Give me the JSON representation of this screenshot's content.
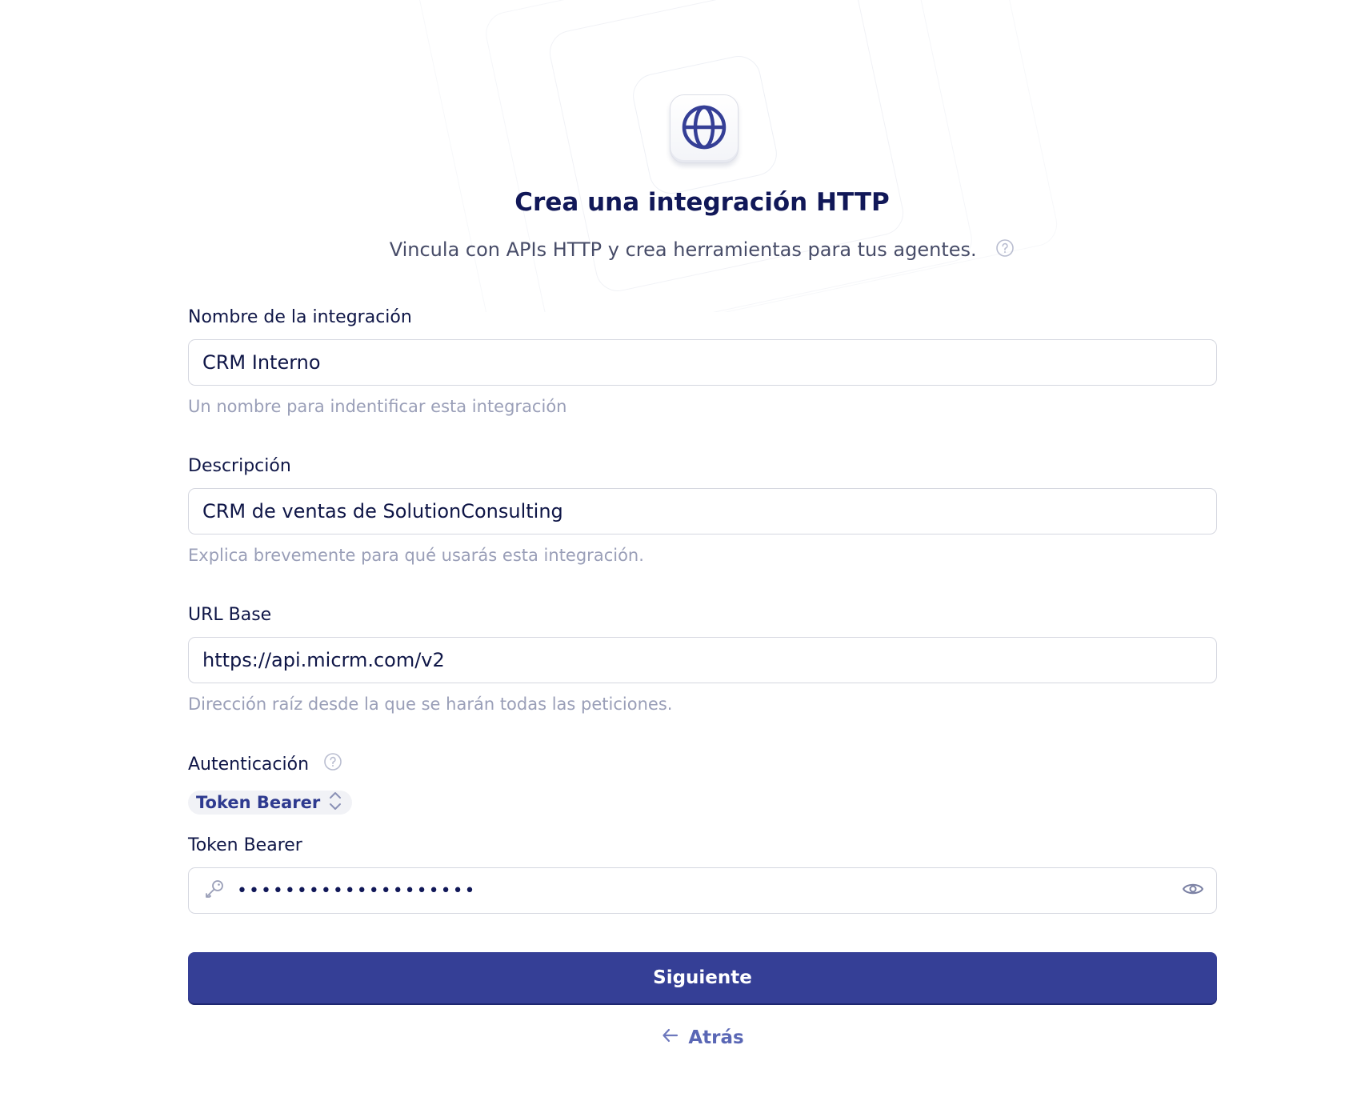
{
  "header": {
    "title": "Crea una integración HTTP",
    "subtitle": "Vincula con APIs HTTP y crea herramientas para tus agentes.",
    "logo_icon": "globe-icon",
    "help_icon": "question-circle-icon"
  },
  "form": {
    "name": {
      "label": "Nombre de la integración",
      "value": "CRM Interno",
      "hint": "Un nombre para indentificar esta integración"
    },
    "description": {
      "label": "Descripción",
      "value": "CRM de ventas de SolutionConsulting",
      "hint": "Explica brevemente para qué usarás esta integración."
    },
    "base_url": {
      "label": "URL Base",
      "value": "https://api.micrm.com/v2",
      "hint": "Dirección raíz desde la que se harán todas las peticiones."
    },
    "auth": {
      "label": "Autenticación",
      "selected": "Token Bearer",
      "select_icon": "chevron-up-down-icon"
    },
    "token": {
      "label": "Token Bearer",
      "value": "••••••••••••••••••••",
      "leading_icon": "key-icon",
      "trailing_icon": "eye-icon"
    }
  },
  "actions": {
    "next_label": "Siguiente",
    "back_label": "Atrás",
    "back_icon": "arrow-left-icon"
  },
  "colors": {
    "primary": "#353f96",
    "heading": "#111858",
    "hint": "#9a9fb8",
    "link": "#5a67b5"
  }
}
